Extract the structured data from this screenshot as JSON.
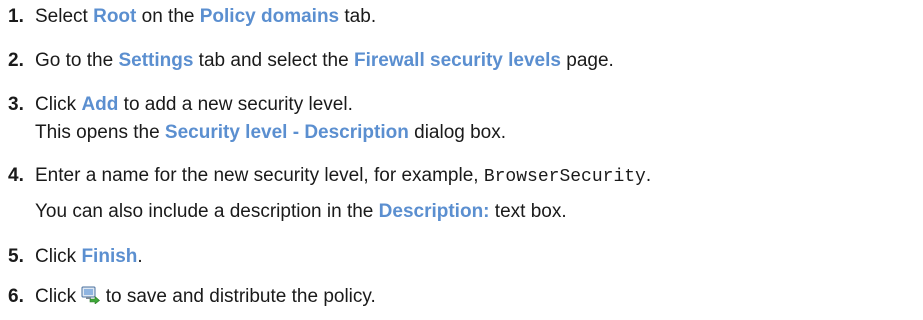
{
  "steps": [
    {
      "num": "1.",
      "t1": "Select ",
      "u1": "Root",
      "t2": " on the ",
      "u2": "Policy domains",
      "t3": " tab."
    },
    {
      "num": "2.",
      "t1": "Go to the ",
      "u1": "Settings",
      "t2": " tab and select the ",
      "u2": "Firewall security levels",
      "t3": " page."
    },
    {
      "num": "3.",
      "t1": "Click ",
      "u1": "Add",
      "t2": " to add a new security level.",
      "l2a": "This opens the ",
      "l2u": "Security level - Description",
      "l2b": " dialog box."
    },
    {
      "num": "4.",
      "t1": "Enter a name for the new security level, for example, ",
      "code": "BrowserSecurity",
      "t2": ".",
      "l2a": "You can also include a description in the ",
      "l2u": "Description:",
      "l2b": " text box."
    },
    {
      "num": "5.",
      "t1": "Click ",
      "u1": "Finish",
      "t2": "."
    },
    {
      "num": "6.",
      "t1": "Click ",
      "icon": "save-and-distribute-icon",
      "t2": " to save and distribute the policy."
    }
  ]
}
